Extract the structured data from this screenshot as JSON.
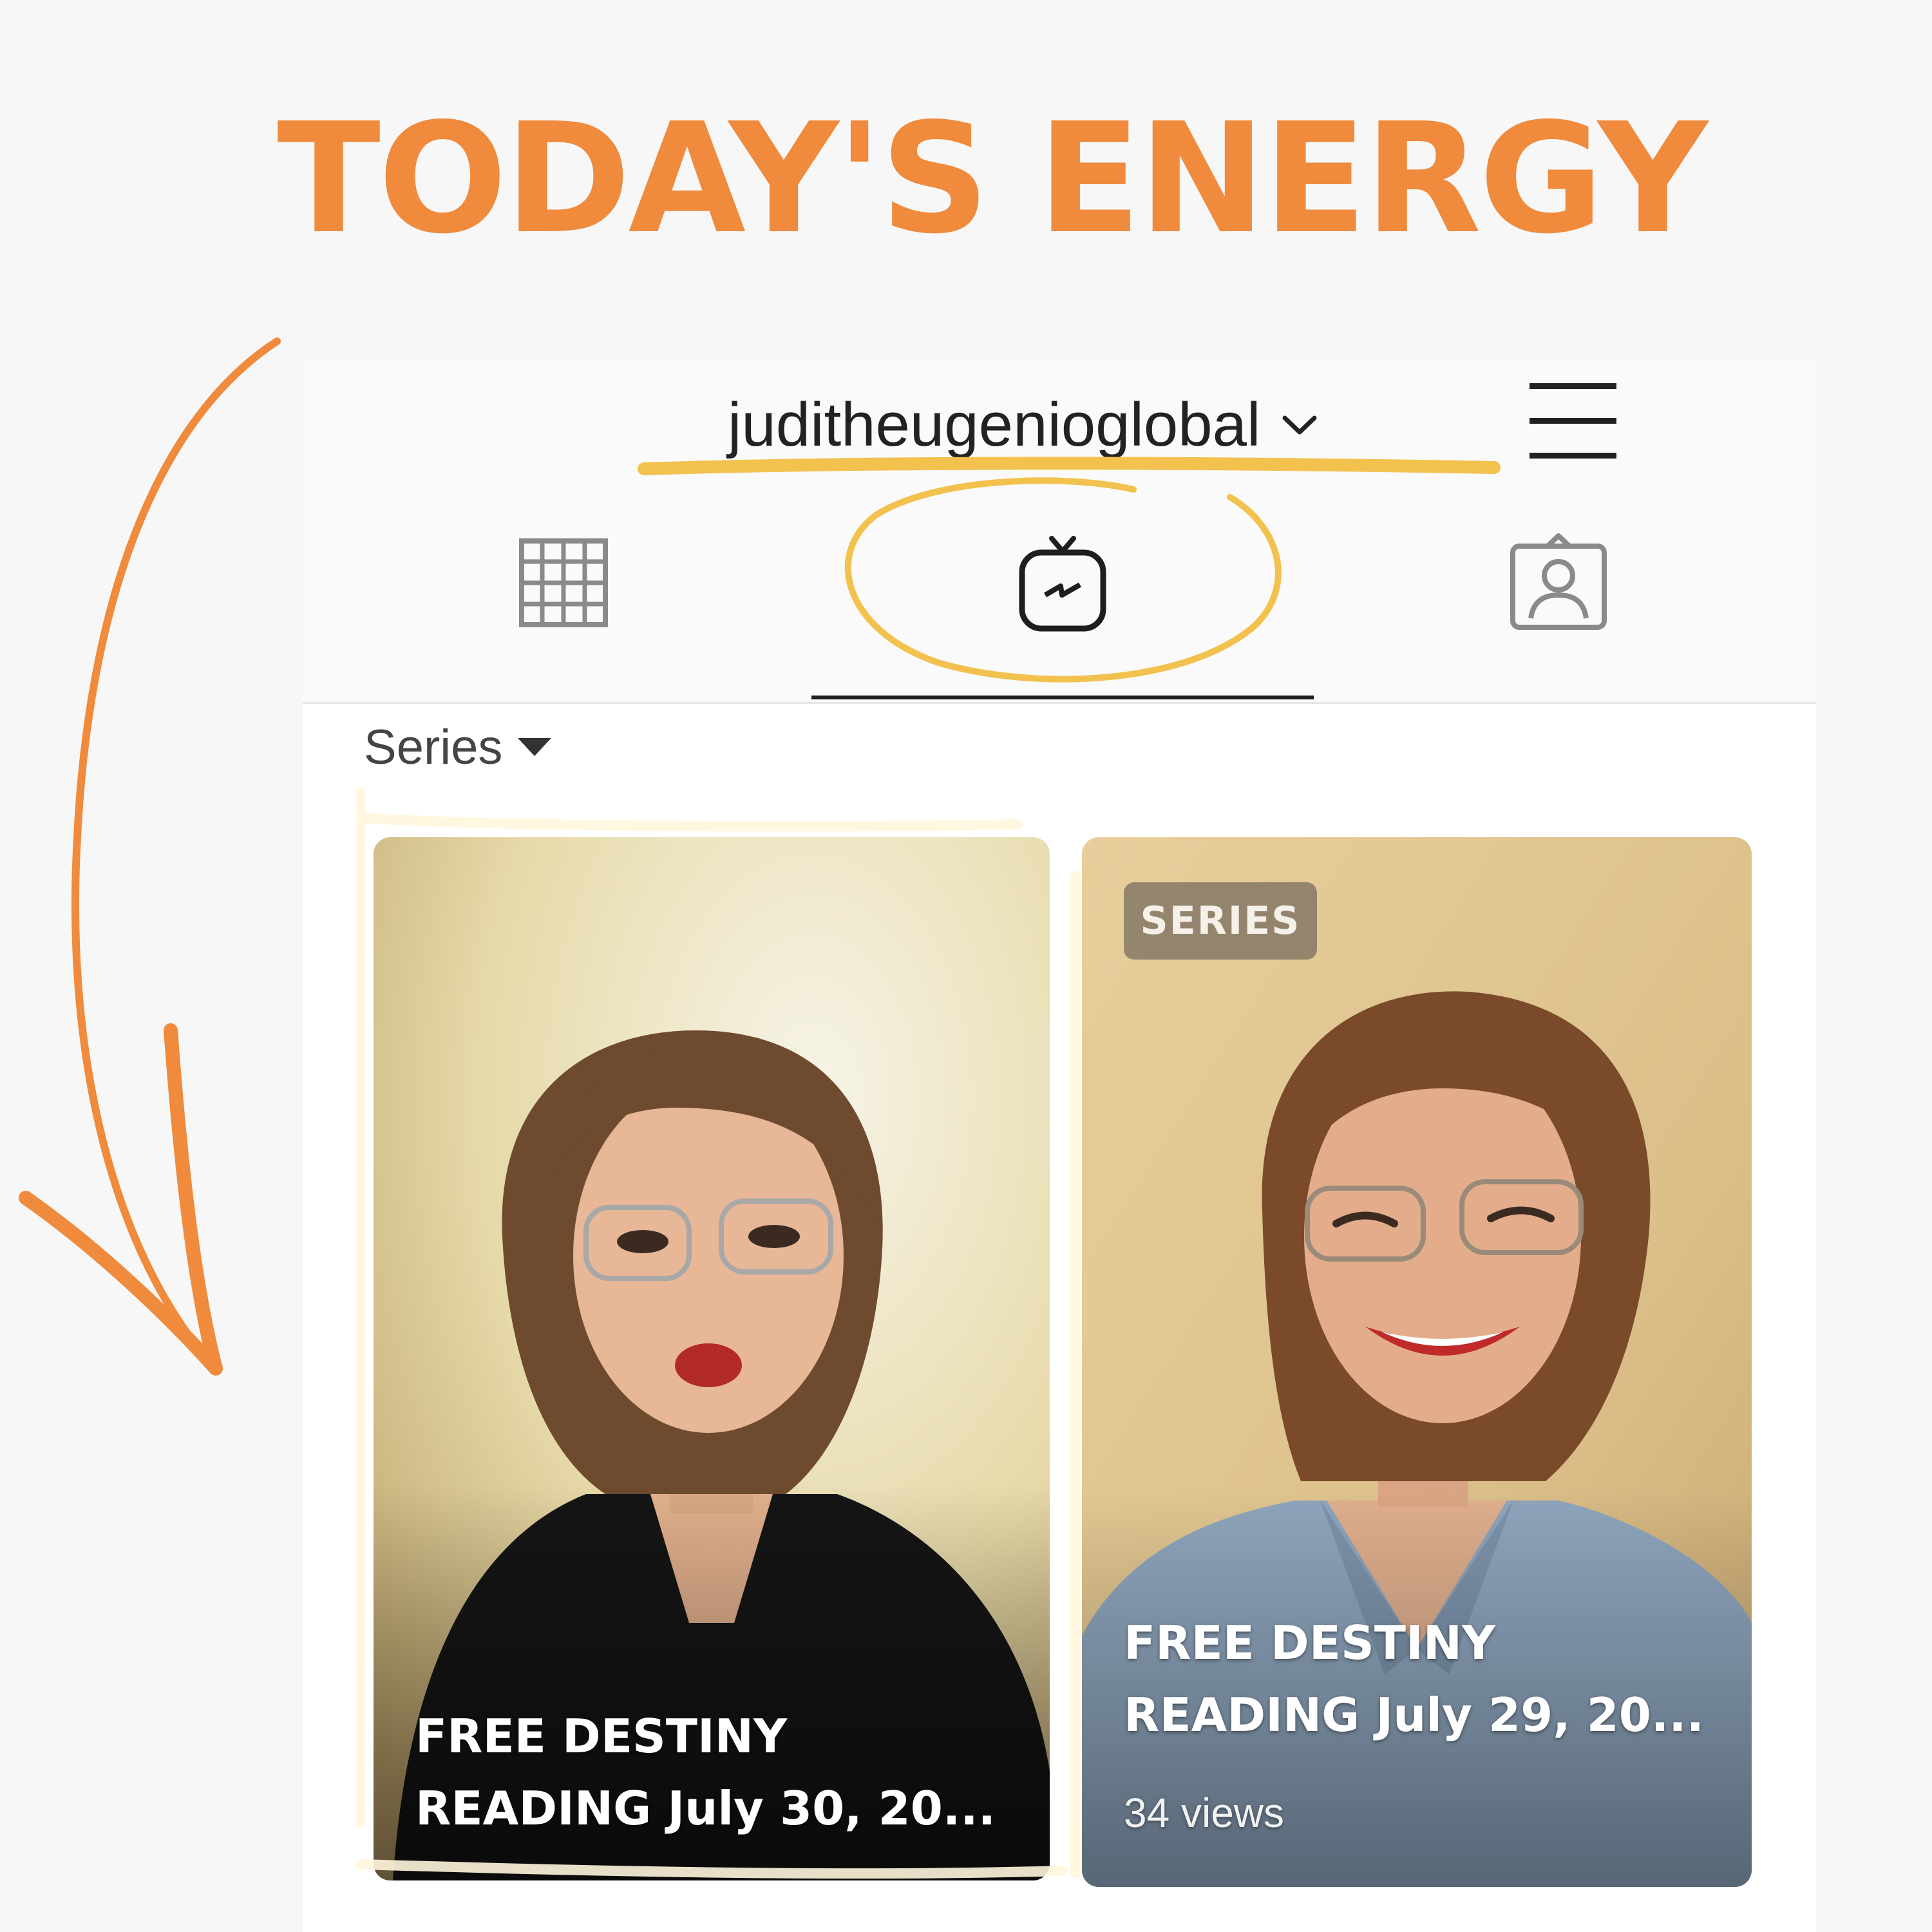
{
  "headline": "TODAY'S ENERGY",
  "header": {
    "username": "juditheugenioglobal"
  },
  "tabs": [
    {
      "icon": "grid-icon",
      "active": false
    },
    {
      "icon": "igtv-icon",
      "active": true
    },
    {
      "icon": "tagged-icon",
      "active": false
    }
  ],
  "filter": {
    "label": "Series"
  },
  "cards": [
    {
      "title": "FREE DESTINY\nREADING July 30, 20...",
      "badge": "",
      "views": ""
    },
    {
      "title": "FREE DESTINY\nREADING July 29, 20...",
      "badge": "SERIES",
      "views": "34 views"
    }
  ],
  "colors": {
    "accent": "#f08a3c",
    "highlight": "#f2c14e"
  }
}
